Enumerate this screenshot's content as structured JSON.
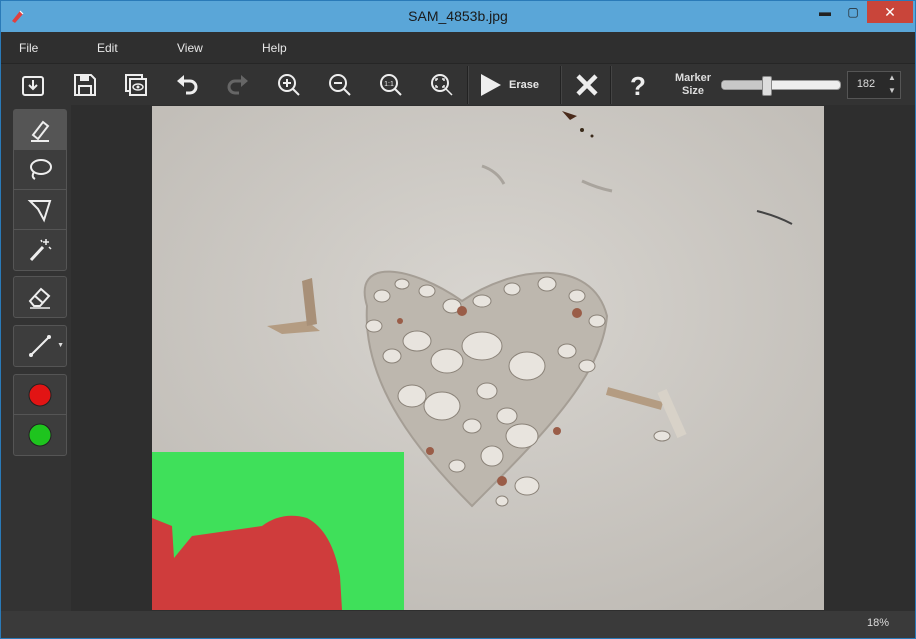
{
  "window": {
    "title": "SAM_4853b.jpg",
    "min_label": "▬",
    "max_label": "▢",
    "close_label": "✕"
  },
  "menu": [
    "File",
    "Edit",
    "View",
    "Help"
  ],
  "toolbar": {
    "erase_label": "Erase",
    "marker_label_1": "Marker",
    "marker_label_2": "Size",
    "marker_value": "182",
    "marker_fraction": 0.37
  },
  "sidebar": {
    "tools": [
      "marker",
      "lasso",
      "polygon-lasso",
      "magic-wand",
      "eraser",
      "line",
      "red-color",
      "green-color"
    ],
    "red": "#e21414",
    "green": "#1ec41e"
  },
  "status": {
    "zoom": "18%"
  }
}
